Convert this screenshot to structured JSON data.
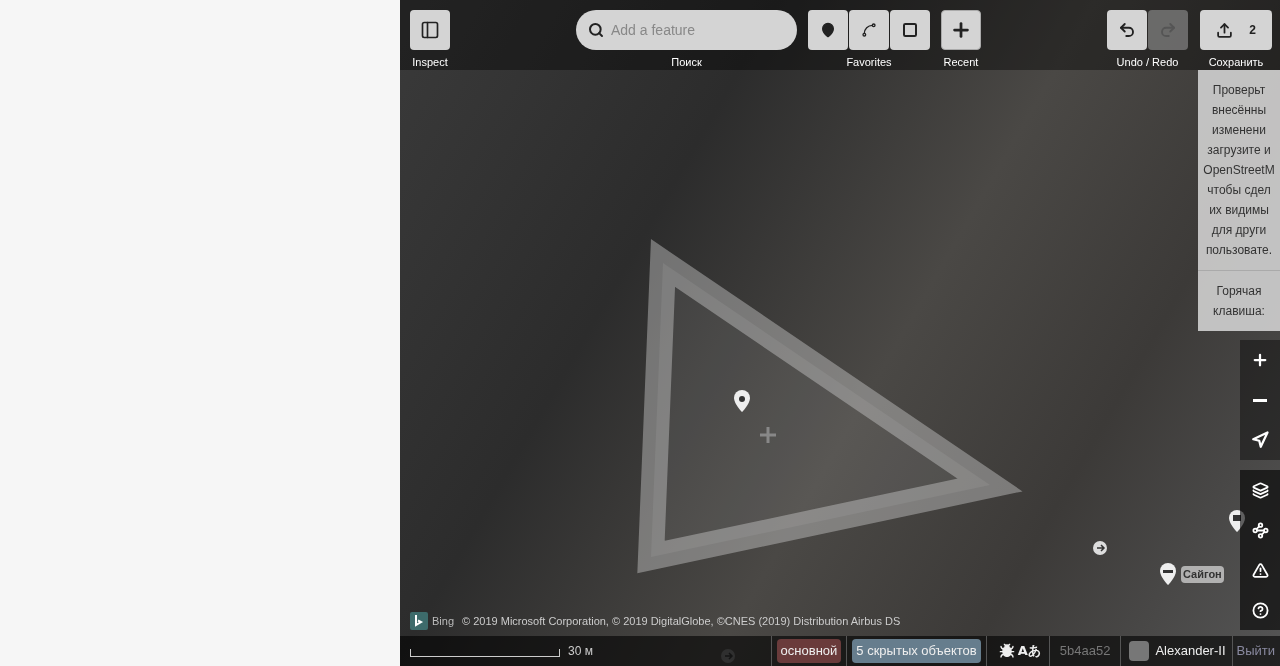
{
  "toolbar": {
    "inspect": {
      "label": "Inspect"
    },
    "search": {
      "placeholder": "Add a feature",
      "label": "Поиск"
    },
    "favorites": {
      "label": "Favorites"
    },
    "recent": {
      "label": "Recent"
    },
    "history": {
      "label": "Undo / Redo",
      "undo_disabled": false,
      "redo_disabled": true
    },
    "save": {
      "count": "2",
      "label": "Сохранить"
    }
  },
  "tooltip": {
    "lines": [
      "Проверьт",
      "внесённы",
      "изменени",
      "загрузите и",
      "OpenStreetM",
      "чтобы сдел",
      "их видимы",
      "для други",
      "пользовате."
    ],
    "hotkey_lines": [
      "Горячая",
      "клавиша:"
    ]
  },
  "map": {
    "labels": [
      "Сайгон"
    ],
    "attribution_logo": "Bing",
    "attribution": "© 2019 Microsoft Corporation, © 2019 DigitalGlobe, ©CNES (2019) Distribution Airbus DS"
  },
  "footer": {
    "scale": "30 м",
    "background": "основной",
    "hidden": "5 скрытых объектов",
    "language": "Aあ",
    "version": "5b4aa52",
    "user": "Alexander-II",
    "logout": "Выйти"
  }
}
